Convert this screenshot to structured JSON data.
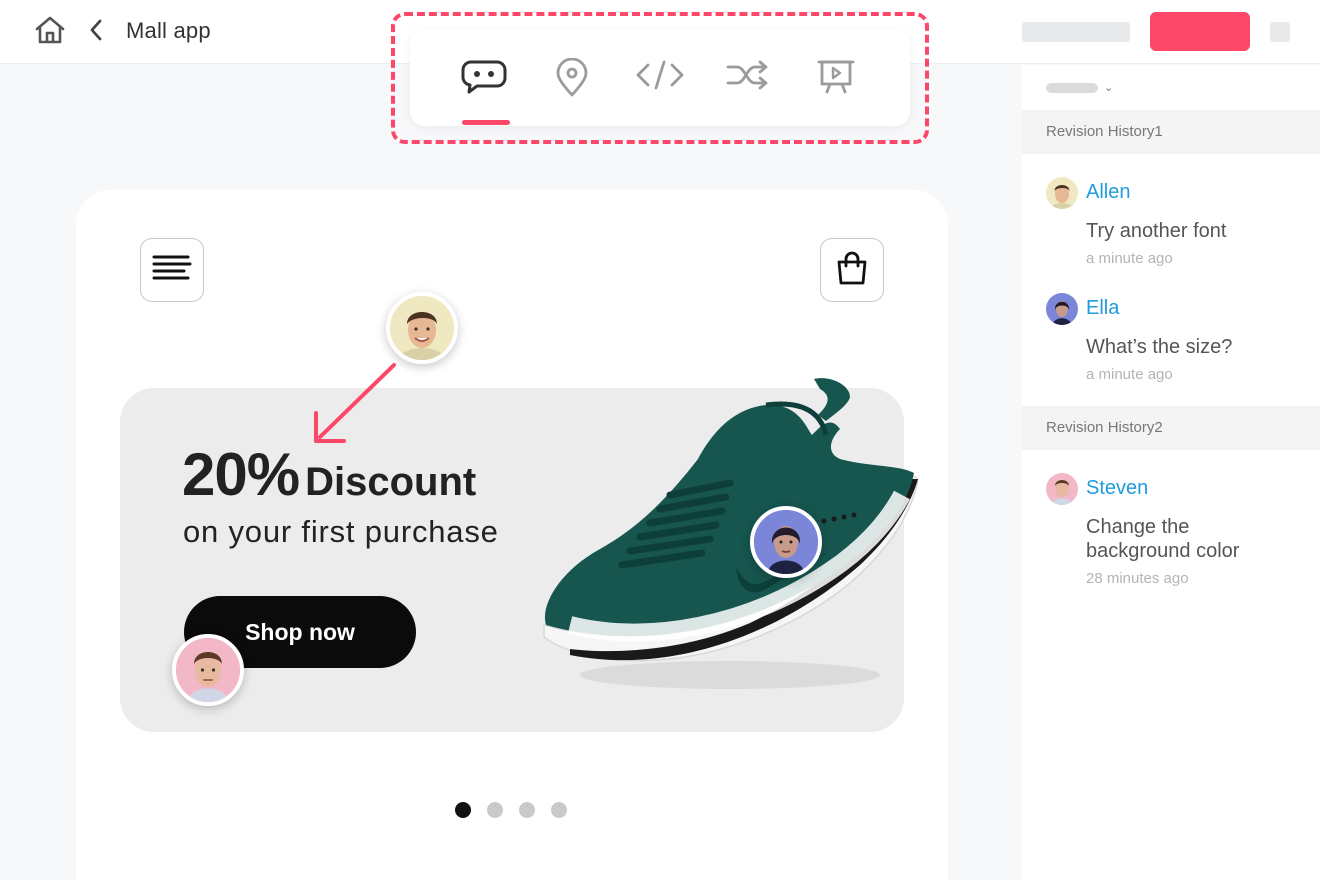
{
  "header": {
    "app_title": "Mall app",
    "icons": {
      "home": "home-icon",
      "back": "chevron-left-icon"
    },
    "primary_action_color": "#fd4768"
  },
  "toolbar": {
    "tools": [
      {
        "name": "comment",
        "icon": "comment-icon",
        "active": true
      },
      {
        "name": "location",
        "icon": "location-pin-icon",
        "active": false
      },
      {
        "name": "code",
        "icon": "code-icon",
        "active": false
      },
      {
        "name": "shuffle",
        "icon": "shuffle-icon",
        "active": false
      },
      {
        "name": "presentation",
        "icon": "presentation-icon",
        "active": false
      }
    ],
    "highlight_color": "#fd4768"
  },
  "canvas": {
    "banner": {
      "headline_pct": "20%",
      "headline_word": "Discount",
      "subline": "on your first purchase",
      "cta_label": "Shop now"
    },
    "icons": {
      "menu": "hamburger-menu-icon",
      "cart": "shopping-bag-icon"
    },
    "carousel": {
      "count": 4,
      "active_index": 0
    }
  },
  "comments_panel": {
    "sections": [
      {
        "title": "Revision History1",
        "comments": [
          {
            "author": "Allen",
            "text": "Try another font",
            "time": "a minute ago"
          },
          {
            "author": "Ella",
            "text": "What’s the size?",
            "time": "a minute ago"
          }
        ]
      },
      {
        "title": "Revision History2",
        "comments": [
          {
            "author": "Steven",
            "text": "Change the background color",
            "time": "28 minutes ago"
          }
        ]
      }
    ],
    "author_color": "#1f9bde"
  }
}
